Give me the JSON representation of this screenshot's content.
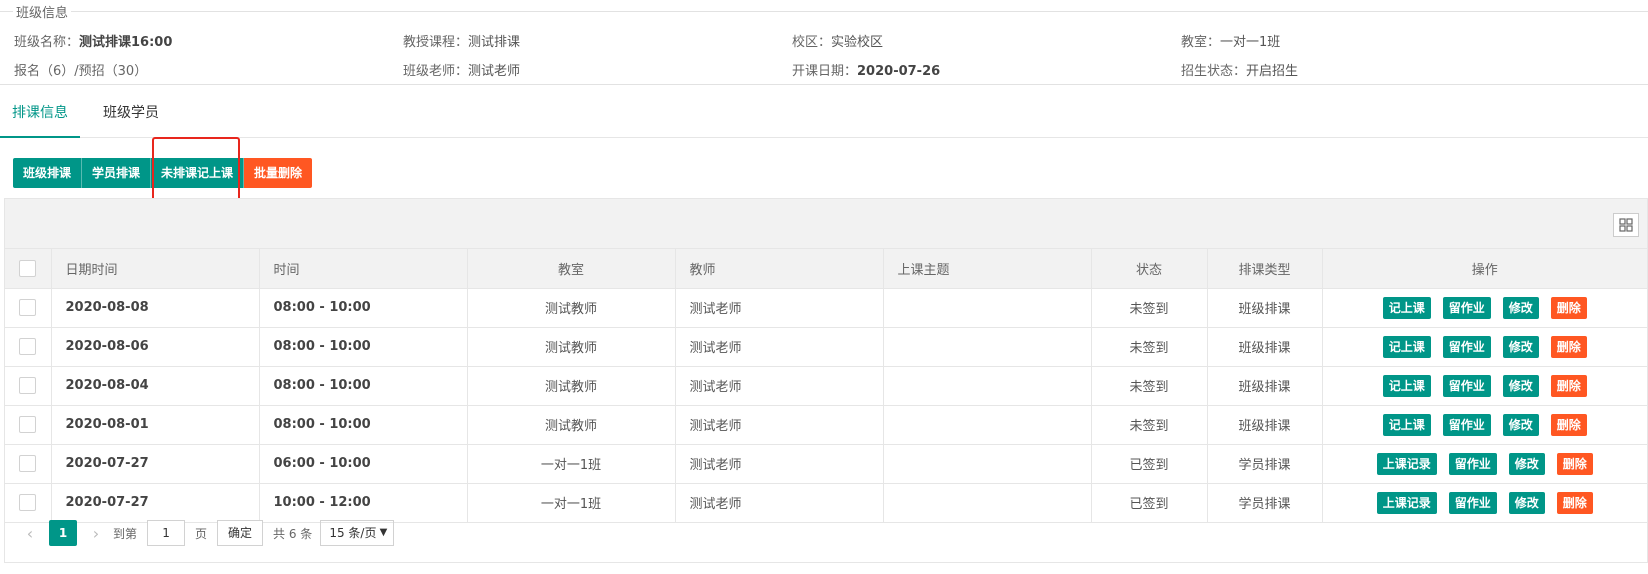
{
  "info": {
    "legend": "班级信息",
    "row1": [
      {
        "label": "班级名称：",
        "value": "测试排课16:00"
      },
      {
        "label": "教授课程：",
        "value": "测试排课"
      },
      {
        "label": "校区：",
        "value": "实验校区"
      },
      {
        "label": "教室：",
        "value": "一对一1班"
      }
    ],
    "row2": [
      {
        "label": "报名（6）/预招（30）",
        "value": ""
      },
      {
        "label": "班级老师：",
        "value": "测试老师"
      },
      {
        "label": "开课日期：",
        "value": "2020-07-26"
      },
      {
        "label": "招生状态：",
        "value": "开启招生"
      }
    ]
  },
  "tabs": [
    {
      "label": "排课信息",
      "active": true
    },
    {
      "label": "班级学员",
      "active": false
    }
  ],
  "buttons": {
    "class_schedule": "班级排课",
    "student_schedule": "学员排课",
    "unscheduled_record": "未排课记上课",
    "batch_delete": "批量删除"
  },
  "table": {
    "headers": [
      "日期时间",
      "时间",
      "教室",
      "教师",
      "上课主题",
      "状态",
      "排课类型",
      "操作"
    ],
    "rows": [
      {
        "date": "2020-08-08",
        "time": "08:00 - 10:00",
        "room": "测试教师",
        "teacher": "测试老师",
        "topic": "",
        "status": "未签到",
        "type": "班级排课",
        "ops": [
          "记上课",
          "留作业",
          "修改",
          "删除"
        ]
      },
      {
        "date": "2020-08-06",
        "time": "08:00 - 10:00",
        "room": "测试教师",
        "teacher": "测试老师",
        "topic": "",
        "status": "未签到",
        "type": "班级排课",
        "ops": [
          "记上课",
          "留作业",
          "修改",
          "删除"
        ]
      },
      {
        "date": "2020-08-04",
        "time": "08:00 - 10:00",
        "room": "测试教师",
        "teacher": "测试老师",
        "topic": "",
        "status": "未签到",
        "type": "班级排课",
        "ops": [
          "记上课",
          "留作业",
          "修改",
          "删除"
        ]
      },
      {
        "date": "2020-08-01",
        "time": "08:00 - 10:00",
        "room": "测试教师",
        "teacher": "测试老师",
        "topic": "",
        "status": "未签到",
        "type": "班级排课",
        "ops": [
          "记上课",
          "留作业",
          "修改",
          "删除"
        ]
      },
      {
        "date": "2020-07-27",
        "time": "06:00 - 10:00",
        "room": "一对一1班",
        "teacher": "测试老师",
        "topic": "",
        "status": "已签到",
        "type": "学员排课",
        "ops": [
          "上课记录",
          "留作业",
          "修改",
          "删除"
        ]
      },
      {
        "date": "2020-07-27",
        "time": "10:00 - 12:00",
        "room": "一对一1班",
        "teacher": "测试老师",
        "topic": "",
        "status": "已签到",
        "type": "学员排课",
        "ops": [
          "上课记录",
          "留作业",
          "修改",
          "删除"
        ]
      }
    ]
  },
  "pager": {
    "current": "1",
    "goto_label": "到第",
    "page_value": "1",
    "page_unit": "页",
    "confirm": "确定",
    "total": "共 6 条",
    "page_size": "15 条/页"
  },
  "colors": {
    "primary": "#009688",
    "danger": "#ff5722",
    "highlight": "#e8261d"
  }
}
